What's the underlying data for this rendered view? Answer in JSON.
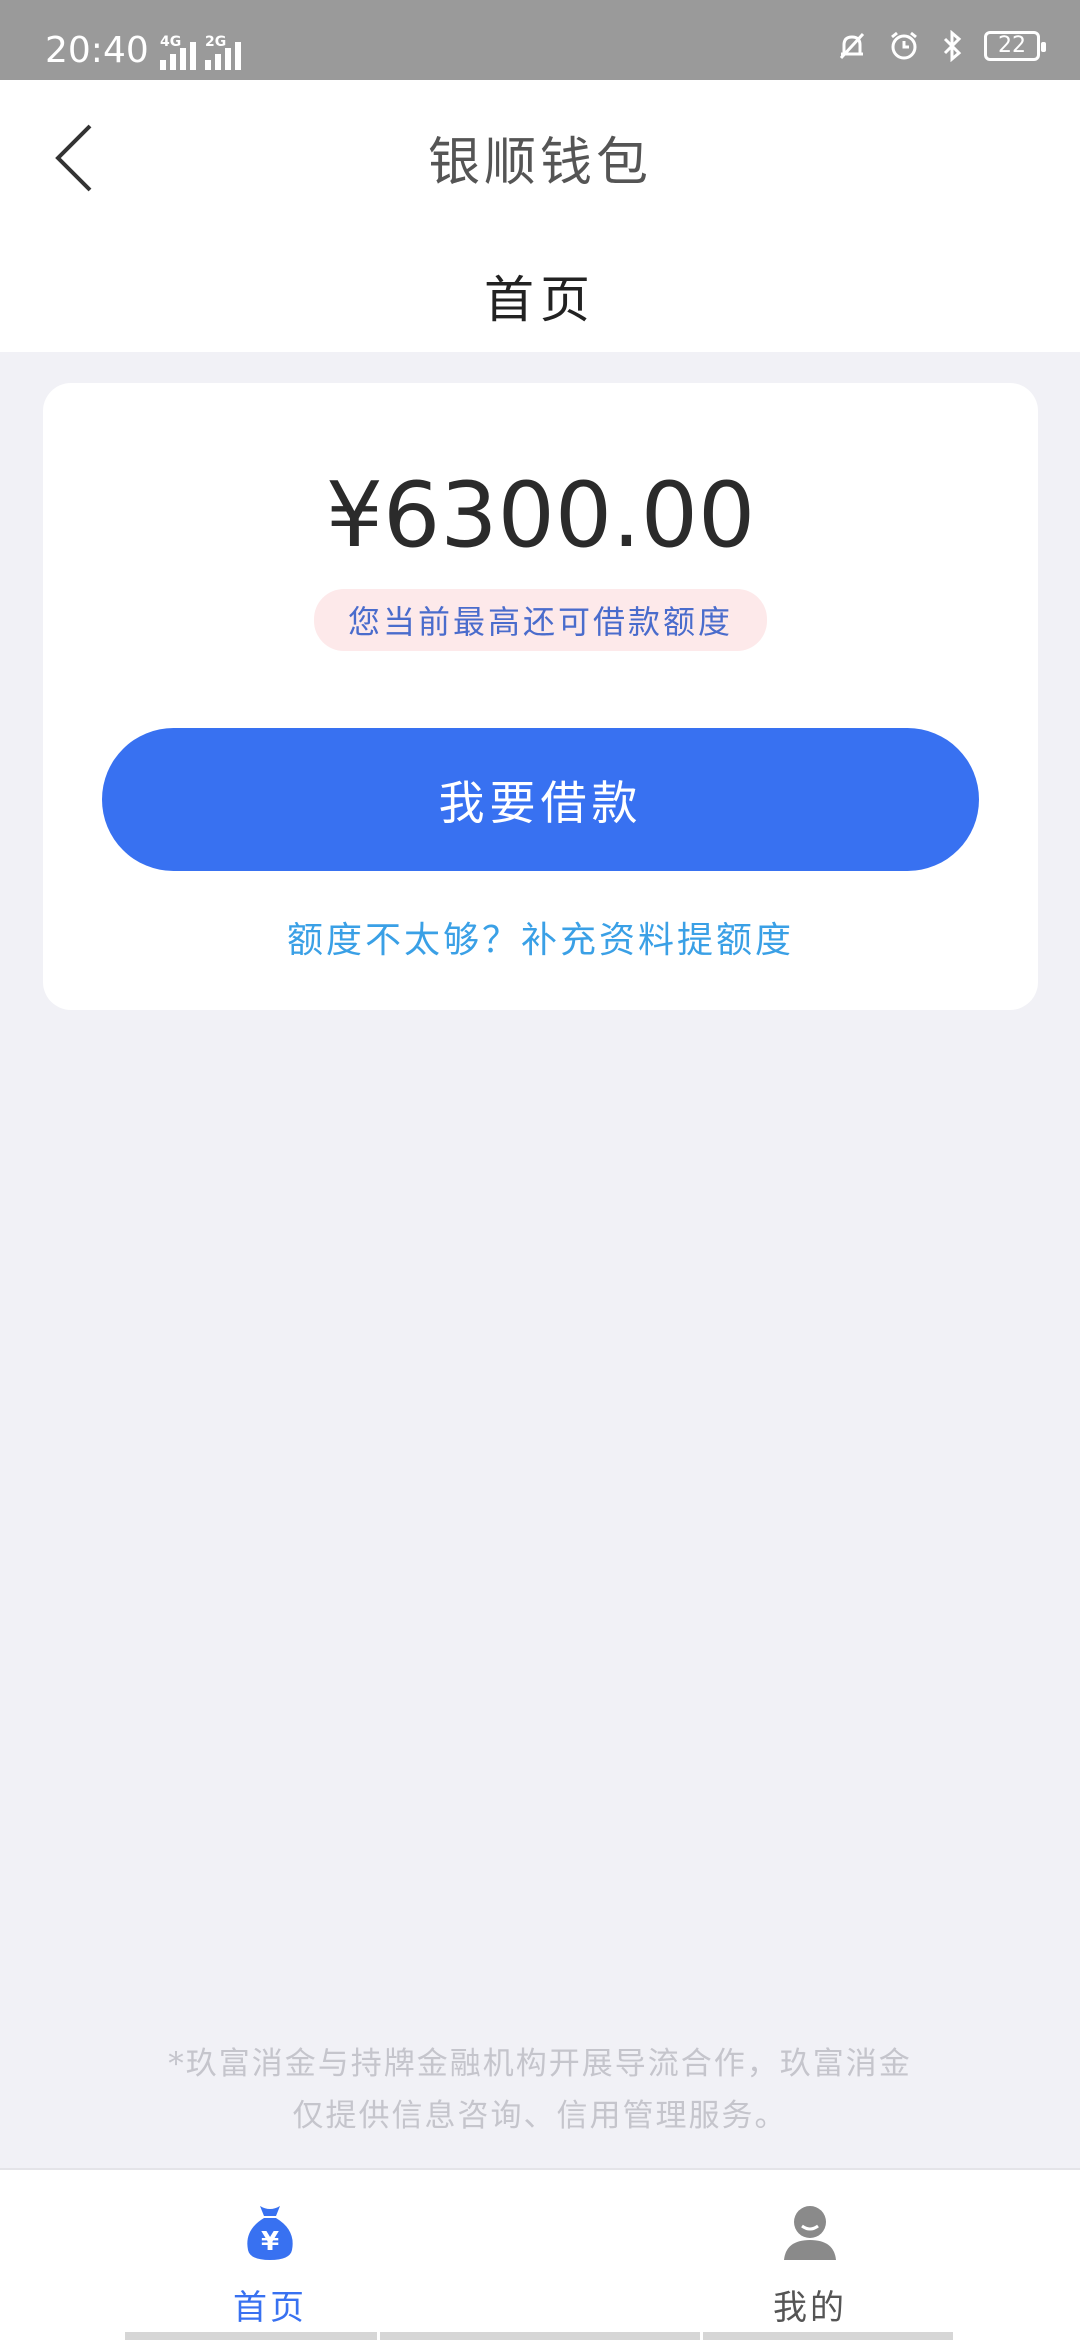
{
  "status_bar": {
    "time": "20:40",
    "network_1": "4G",
    "network_2": "2G",
    "battery": "22"
  },
  "header": {
    "app_title": "银顺钱包",
    "page_title": "首页"
  },
  "card": {
    "amount": "¥6300.00",
    "hint": "您当前最高还可借款额度",
    "loan_button": "我要借款",
    "increase_link": "额度不太够？补充资料提额度"
  },
  "disclaimer": {
    "line1": "*玖富消金与持牌金融机构开展导流合作，玖富消金",
    "line2": "仅提供信息咨询、信用管理服务。"
  },
  "tabbar": {
    "home": "首页",
    "mine": "我的"
  },
  "colors": {
    "primary": "#3871f1",
    "link": "#3aa0e6",
    "background": "#f1f1f6"
  }
}
